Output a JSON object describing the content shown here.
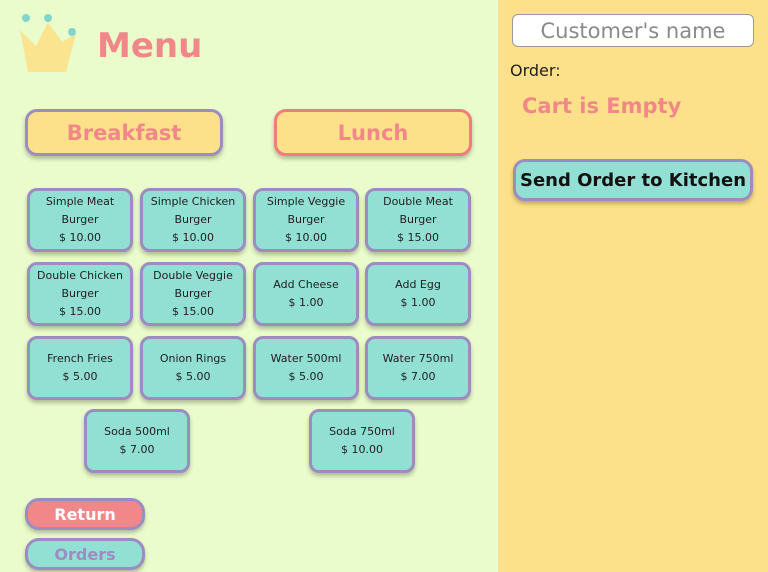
{
  "header": {
    "title": "Menu",
    "logo_icon": "crown-icon"
  },
  "categories": [
    {
      "label": "Breakfast"
    },
    {
      "label": "Lunch"
    }
  ],
  "items": [
    {
      "name": "Simple Meat Burger",
      "price": "$ 10.00"
    },
    {
      "name": "Simple Chicken Burger",
      "price": "$ 10.00"
    },
    {
      "name": "Simple Veggie Burger",
      "price": "$ 10.00"
    },
    {
      "name": "Double Meat Burger",
      "price": "$ 15.00"
    },
    {
      "name": "Double Chicken Burger",
      "price": "$ 15.00"
    },
    {
      "name": "Double Veggie Burger",
      "price": "$ 15.00"
    },
    {
      "name": "Add Cheese",
      "price": "$ 1.00"
    },
    {
      "name": "Add Egg",
      "price": "$ 1.00"
    },
    {
      "name": "French Fries",
      "price": "$ 5.00"
    },
    {
      "name": "Onion Rings",
      "price": "$ 5.00"
    },
    {
      "name": "Water 500ml",
      "price": "$ 5.00"
    },
    {
      "name": "Water 750ml",
      "price": "$ 7.00"
    },
    {
      "name": "Soda 500ml",
      "price": "$ 7.00"
    },
    {
      "name": "Soda 750ml",
      "price": "$ 10.00"
    }
  ],
  "nav": {
    "return_label": "Return",
    "orders_label": "Orders"
  },
  "order_panel": {
    "customer_placeholder": "Customer's name",
    "customer_value": "",
    "order_label": "Order:",
    "cart_status": "Cart is Empty",
    "send_label": "Send Order to Kitchen"
  },
  "colors": {
    "left_bg": "#eafccb",
    "right_bg": "#fde18a",
    "accent_pink": "#f2878a",
    "item_teal": "#92e0d4",
    "border_purple": "#9c8cc2"
  }
}
